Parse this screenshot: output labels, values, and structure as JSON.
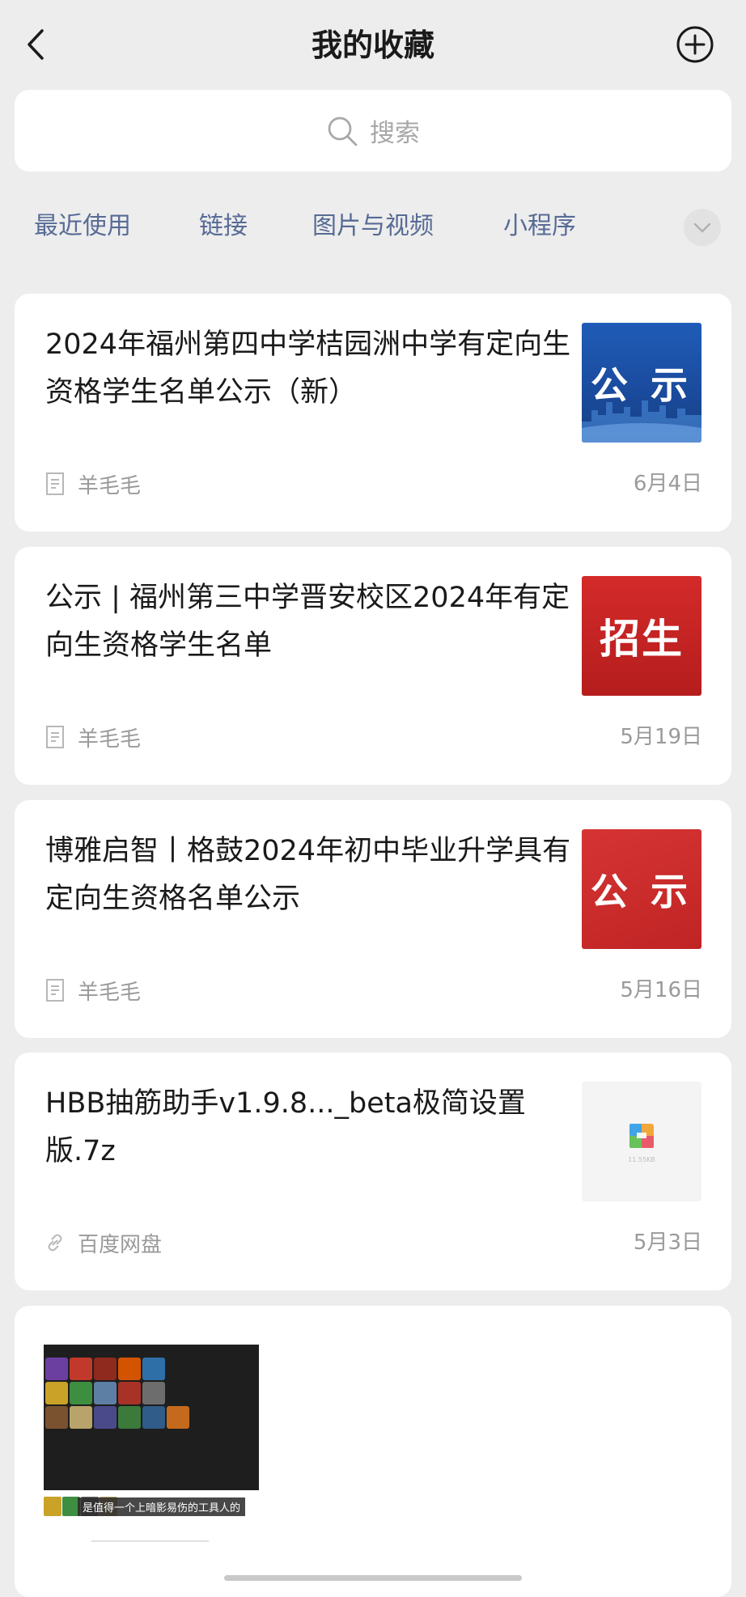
{
  "header": {
    "title": "我的收藏"
  },
  "search": {
    "placeholder": "搜索"
  },
  "tabs": [
    {
      "label": "最近使用"
    },
    {
      "label": "链接"
    },
    {
      "label": "图片与视频"
    },
    {
      "label": "小程序"
    }
  ],
  "cards": [
    {
      "title": "2024年福州第四中学桔园洲中学有定向生资格学生名单公示（新）",
      "thumb_text": "公 示",
      "source": "羊毛毛",
      "source_icon": "article-icon",
      "date": "6月4日"
    },
    {
      "title": "公示 | 福州第三中学晋安校区2024年有定向生资格学生名单",
      "thumb_text": "招生",
      "source": "羊毛毛",
      "source_icon": "article-icon",
      "date": "5月19日"
    },
    {
      "title": "博雅启智丨格鼓2024年初中毕业升学具有定向生资格名单公示",
      "thumb_text": "公 示",
      "source": "羊毛毛",
      "source_icon": "article-icon",
      "date": "5月16日"
    },
    {
      "title": "HBB抽筋助手v1.9.8..._beta极简设置版.7z",
      "thumb_text": "11.55KB",
      "source": "百度网盘",
      "source_icon": "link-icon",
      "date": "5月3日"
    }
  ],
  "video_card": {
    "subtitle": "是值得一个上暗影易伤的工具人的"
  },
  "colors": {
    "tab_text": "#576b95",
    "background": "#ededed",
    "card_bg": "#ffffff",
    "meta_text": "#9a9a9a"
  }
}
